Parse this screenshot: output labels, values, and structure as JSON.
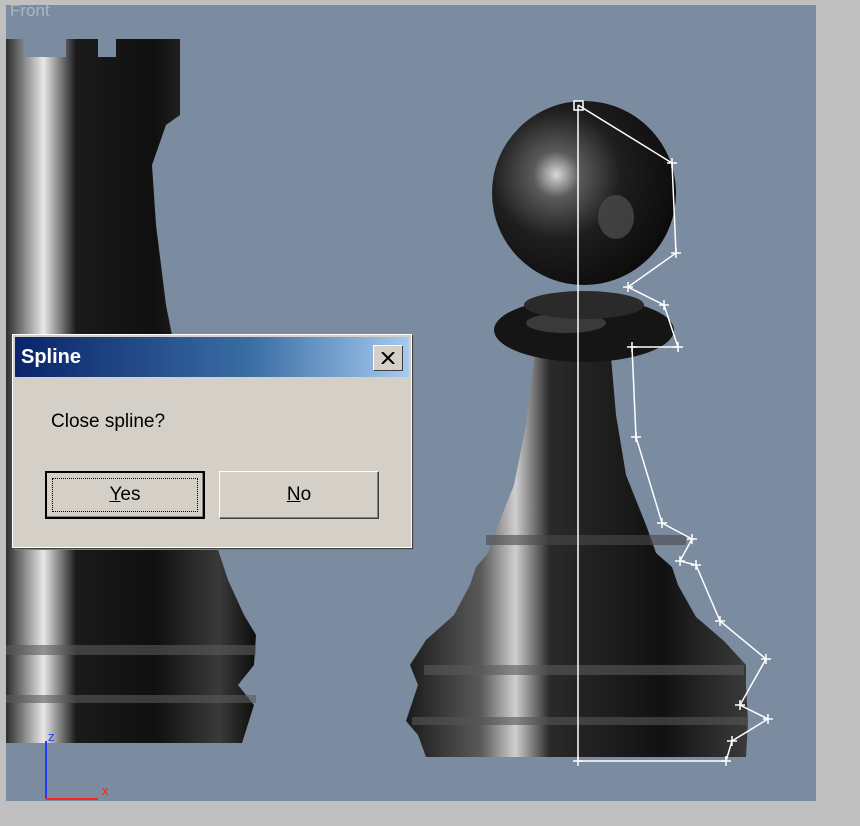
{
  "viewport": {
    "label": "Front",
    "axis_labels": {
      "vertical": "z",
      "horizontal": "x"
    }
  },
  "dialog": {
    "title": "Spline",
    "message": "Close spline?",
    "buttons": {
      "yes": {
        "mnemonic": "Y",
        "rest": "es"
      },
      "no": {
        "mnemonic": "N",
        "rest": "o"
      }
    }
  },
  "colors": {
    "viewport_bg": "#7b8ba0",
    "titlebar_start": "#0a246a",
    "titlebar_end": "#a6caf0",
    "spline": "#ffffff",
    "axis_vertical": "#1e3cff",
    "axis_horizontal": "#ff2020"
  }
}
